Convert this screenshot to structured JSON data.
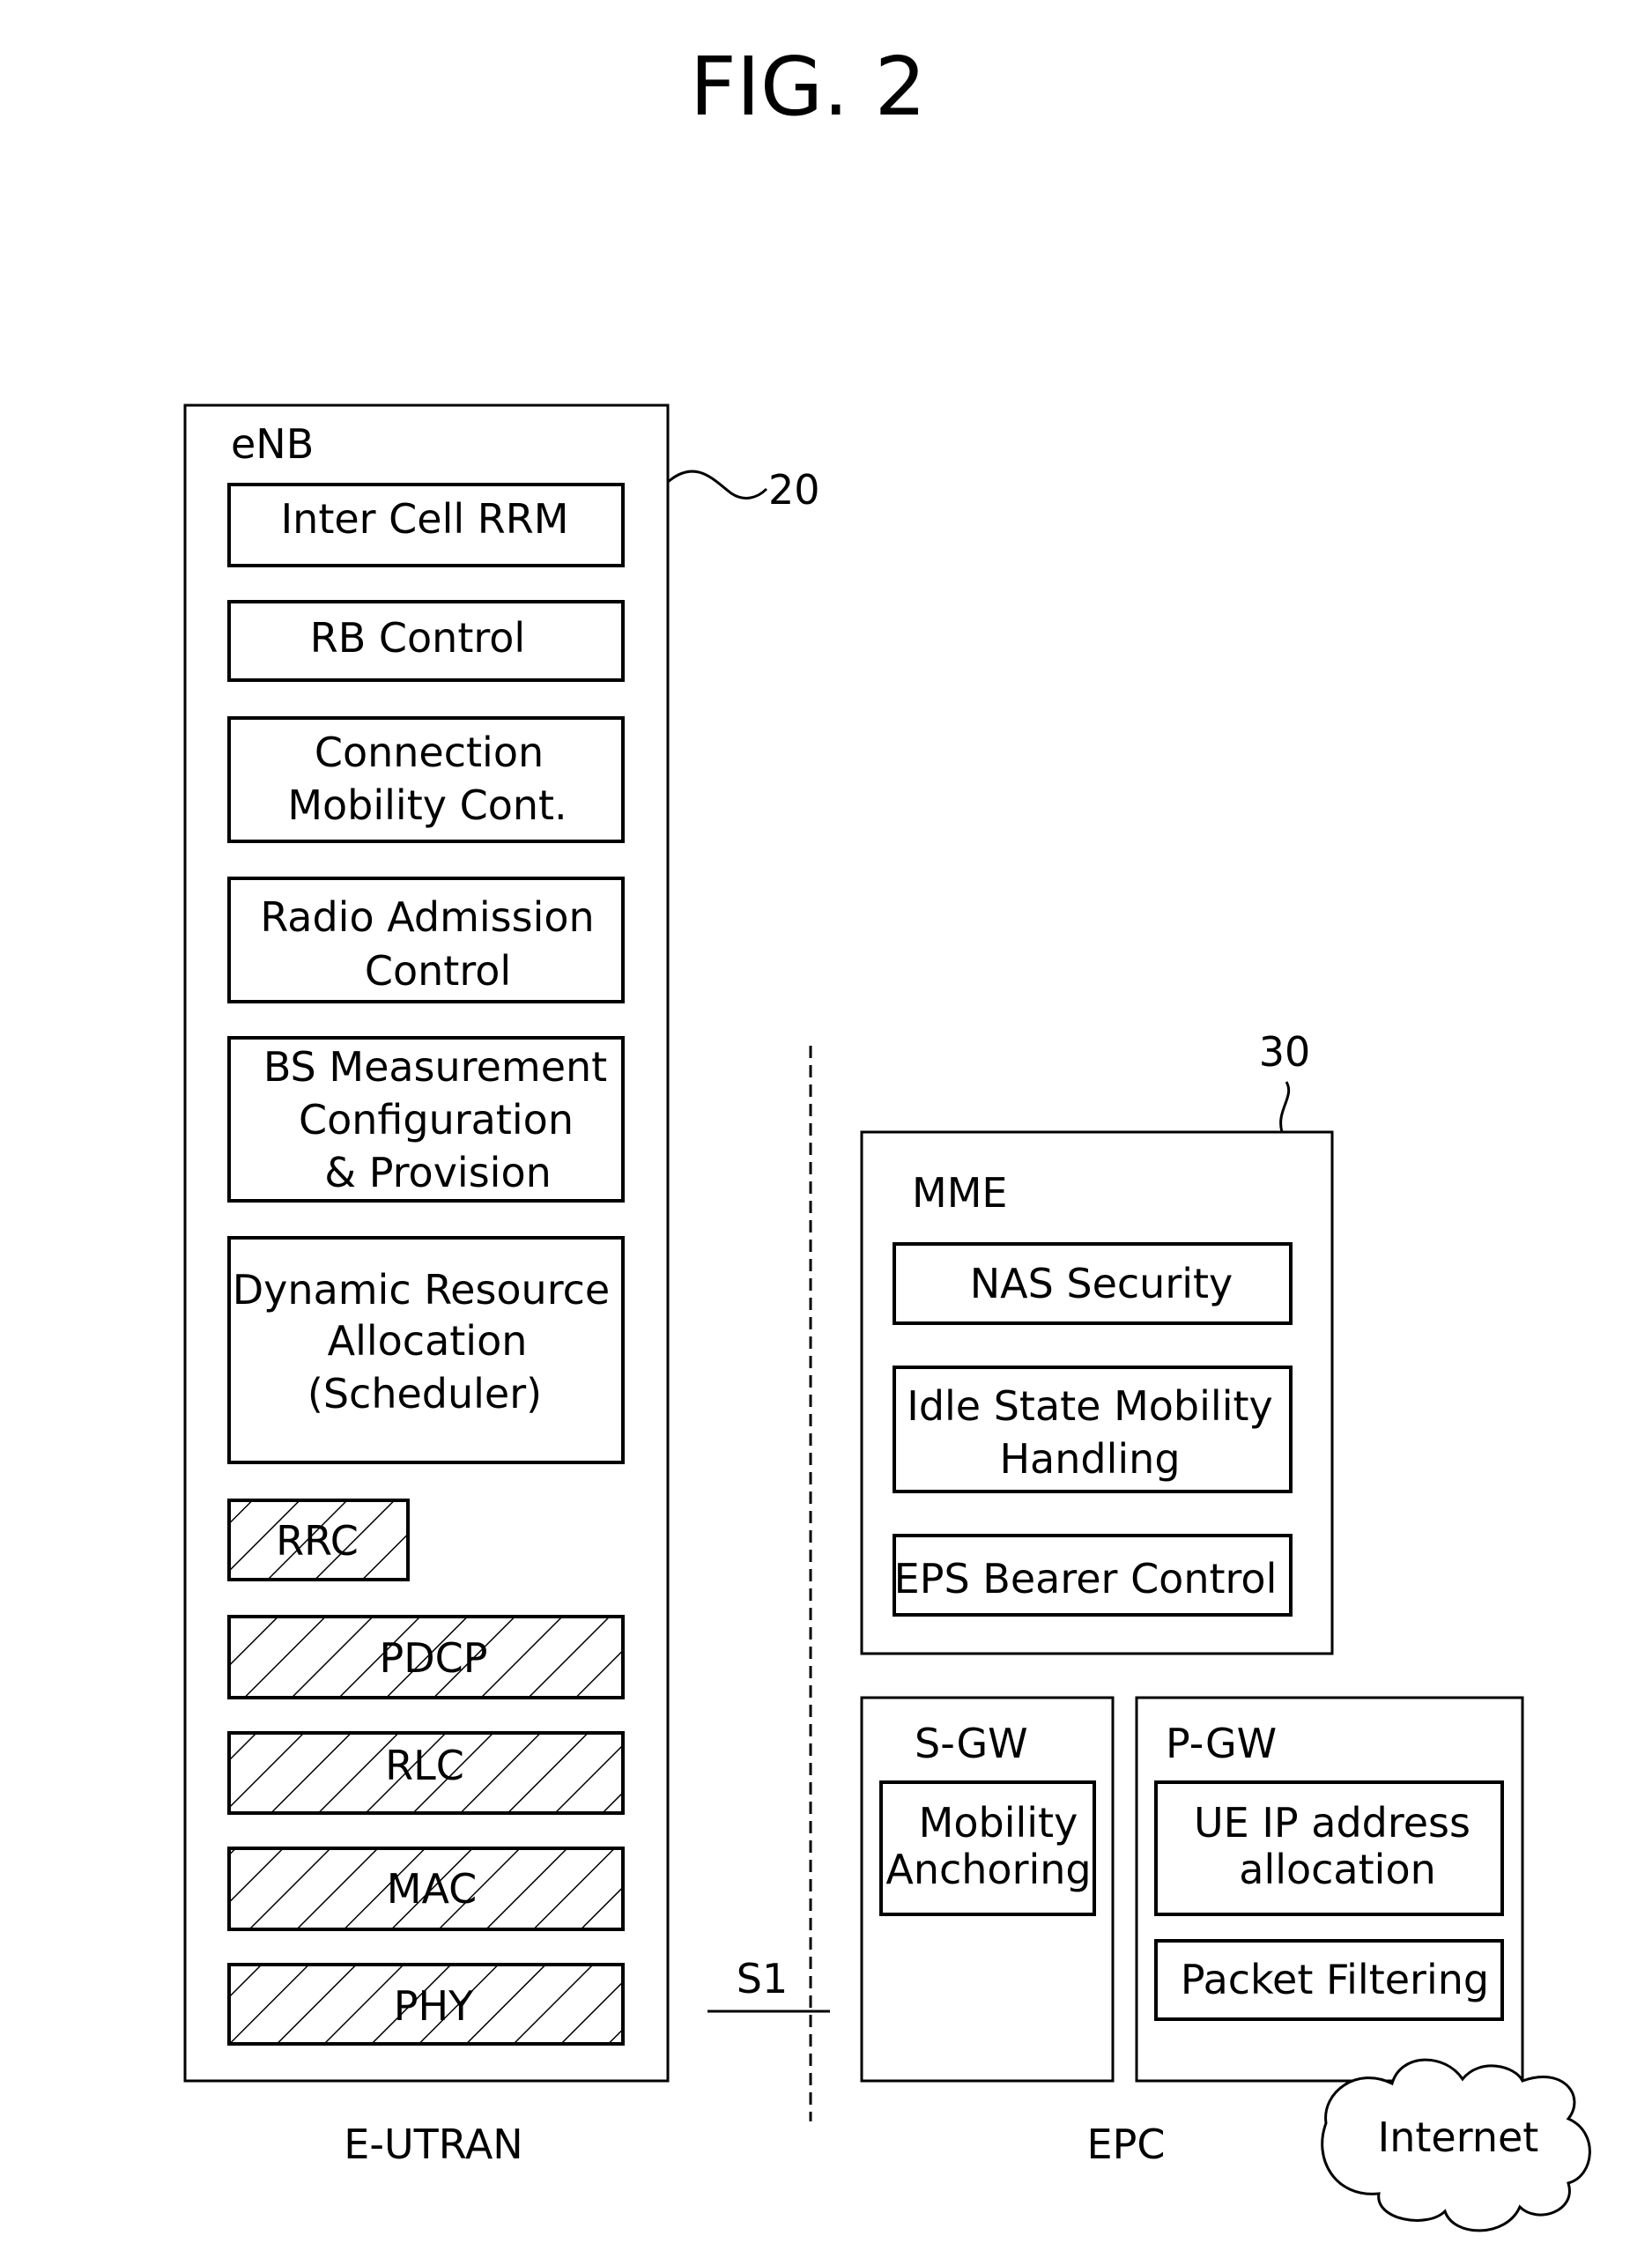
{
  "figure": {
    "title": "FIG. 2"
  },
  "enb": {
    "label": "eNB",
    "ref": "20",
    "functions": [
      {
        "lines": [
          "Inter Cell RRM"
        ]
      },
      {
        "lines": [
          "RB Control"
        ]
      },
      {
        "lines": [
          "Connection",
          "Mobility Cont."
        ]
      },
      {
        "lines": [
          "Radio Admission",
          "Control"
        ]
      },
      {
        "lines": [
          "BS Measurement",
          "Configuration",
          "& Provision"
        ]
      },
      {
        "lines": [
          "Dynamic Resource",
          "Allocation",
          "(Scheduler)"
        ]
      }
    ],
    "protocol_layers": [
      "RRC",
      "PDCP",
      "RLC",
      "MAC",
      "PHY"
    ]
  },
  "interface": {
    "label": "S1"
  },
  "mme": {
    "label": "MME",
    "ref": "30",
    "functions": [
      {
        "lines": [
          "NAS Security"
        ]
      },
      {
        "lines": [
          "Idle State Mobility",
          "Handling"
        ]
      },
      {
        "lines": [
          "EPS Bearer Control"
        ]
      }
    ]
  },
  "sgw": {
    "label": "S-GW",
    "functions": [
      {
        "lines": [
          "Mobility",
          "Anchoring"
        ]
      }
    ]
  },
  "pgw": {
    "label": "P-GW",
    "functions": [
      {
        "lines": [
          "UE IP address",
          "allocation"
        ]
      },
      {
        "lines": [
          "Packet Filtering"
        ]
      }
    ]
  },
  "regions": {
    "left": "E-UTRAN",
    "right": "EPC"
  },
  "cloud": {
    "label": "Internet"
  }
}
